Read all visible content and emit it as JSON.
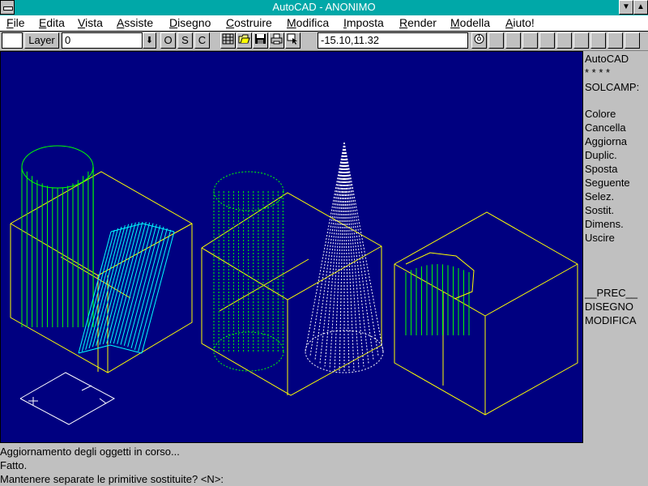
{
  "window": {
    "title": "AutoCAD - ANONIMO",
    "minimize_glyph": "▼",
    "maximize_glyph": "▲"
  },
  "menubar": [
    {
      "label": "File",
      "underline": "F",
      "rest": "ile"
    },
    {
      "label": "Edita",
      "underline": "E",
      "rest": "dita"
    },
    {
      "label": "Vista",
      "underline": "V",
      "rest": "ista"
    },
    {
      "label": "Assiste",
      "underline": "A",
      "rest": "ssiste"
    },
    {
      "label": "Disegno",
      "underline": "D",
      "rest": "isegno"
    },
    {
      "label": "Costruire",
      "underline": "C",
      "rest": "ostruire"
    },
    {
      "label": "Modifica",
      "underline": "M",
      "rest": "odifica"
    },
    {
      "label": "Imposta",
      "underline": "I",
      "rest": "mposta"
    },
    {
      "label": "Render",
      "underline": "R",
      "rest": "ender"
    },
    {
      "label": "Modella",
      "underline": "M",
      "rest": "odella"
    },
    {
      "label": "Aiuto!",
      "underline": "A",
      "rest": "iuto!"
    }
  ],
  "toolbar": {
    "layer_button": "Layer",
    "layer_value": "0",
    "dropdown_glyph": "⬇",
    "ortho": "O",
    "snap": "S",
    "coords_toggle": "C",
    "coordinates": "-15.10,11.32",
    "icons": [
      "grid-icon",
      "open-file-icon",
      "save-icon",
      "print-icon",
      "select-icon",
      "aerial-view-icon"
    ],
    "accent": "#ffff00"
  },
  "screen_menu": {
    "header": [
      "AutoCAD",
      "* * * *",
      "SOLCAMP:"
    ],
    "items": [
      "Colore",
      "Cancella",
      "Aggiorna",
      "Duplic.",
      "Sposta",
      "Seguente",
      "Selez.",
      "Sostit.",
      "Dimens.",
      "Uscire"
    ],
    "footer": [
      "__PREC__",
      "DISEGNO",
      "MODIFICA"
    ]
  },
  "command_lines": [
    "Aggiornamento degli oggetti in corso...",
    "Fatto.",
    "Mantenere separate le primitive sostituite? <N>:"
  ],
  "colors": {
    "titlebar": "#00a8a8",
    "canvas": "#000080",
    "edges": "#ffff00",
    "cylinder_mesh": "#00ff00",
    "arch_mesh": "#00ffff",
    "cone_mesh": "#ffffff"
  }
}
